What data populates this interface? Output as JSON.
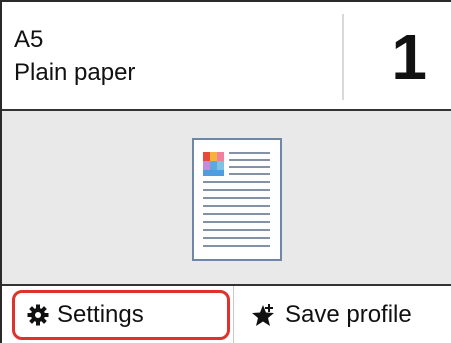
{
  "header": {
    "paper_size": "A5",
    "paper_type": "Plain paper",
    "copies": "1"
  },
  "preview": {
    "icon": "document-preview-icon"
  },
  "footer": {
    "settings_label": "Settings",
    "settings_icon": "gear-icon",
    "save_profile_label": "Save profile",
    "save_profile_icon": "star-add-icon"
  },
  "colors": {
    "highlight_border": "#e0322d",
    "preview_background": "#e9e9e9",
    "divider": "#333333"
  }
}
